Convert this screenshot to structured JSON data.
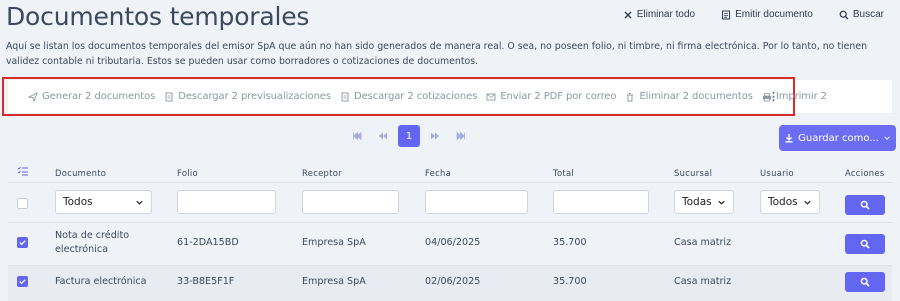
{
  "page": {
    "title": "Documentos temporales",
    "description": "Aquí se listan los documentos temporales del emisor          SpA que aún no han sido generados de manera real. O sea, no poseen folio, ni timbre, ni firma electrónica. Por lo tanto, no tienen validez contable ni tributaria. Estos se pueden usar como borradores o cotizaciones de documentos."
  },
  "top_actions": {
    "delete_all": "Eliminar todo",
    "issue": "Emitir documento",
    "search": "Buscar"
  },
  "bulk": {
    "generate": "Generar 2 documentos",
    "download_previews": "Descargar 2 previsualizaciones",
    "download_quotes": "Descargar 2 cotizaciones",
    "email": "Enviar 2 PDF por correo",
    "delete": "Eliminar 2 documentos",
    "print": "Imprimir 2"
  },
  "pagination": {
    "current_page": "1"
  },
  "save_as": "Guardar como...",
  "columns": {
    "documento": "Documento",
    "folio": "Folio",
    "receptor": "Receptor",
    "fecha": "Fecha",
    "total": "Total",
    "sucursal": "Sucursal",
    "usuario": "Usuario",
    "acciones": "Acciones"
  },
  "filters": {
    "documento": "Todos",
    "sucursal": "Todas",
    "usuario": "Todos"
  },
  "rows": [
    {
      "documento_line1": "Nota de crédito",
      "documento_line2": "electrónica",
      "folio": "61-2DA15BD",
      "receptor": "Empresa SpA",
      "fecha": "04/06/2025",
      "total": "35.700",
      "sucursal": "Casa matriz"
    },
    {
      "documento_line1": "Factura electrónica",
      "folio": "33-B8E5F1F",
      "receptor": "Empresa SpA",
      "fecha": "02/06/2025",
      "total": "35.700",
      "sucursal": "Casa matriz"
    }
  ],
  "colors": {
    "accent": "#6366f1",
    "highlight_border": "#d72a2a"
  }
}
